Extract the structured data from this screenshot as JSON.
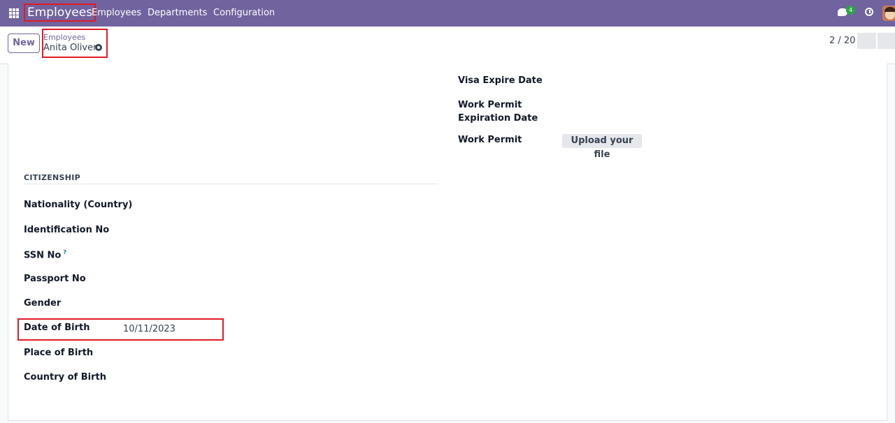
{
  "topbar": {
    "app_name": "Employees",
    "menu": [
      "Employees",
      "Departments",
      "Configuration"
    ],
    "chat_count": "4",
    "colors": {
      "navbar": "#71639e",
      "highlight": "#e01b24"
    }
  },
  "control": {
    "new_label": "New",
    "breadcrumb_parent": "Employees",
    "breadcrumb_current": "Anita Oliver",
    "pager": "2 / 20"
  },
  "form": {
    "right_labels": {
      "visa_expire": "Visa Expire Date",
      "work_permit_exp_1": "Work Permit",
      "work_permit_exp_2": "Expiration Date",
      "work_permit": "Work Permit",
      "upload": "Upload your file"
    },
    "citizenship": {
      "title": "CITIZENSHIP",
      "nationality": "Nationality (Country)",
      "identification": "Identification No",
      "ssn": "SSN No",
      "ssn_help": "?",
      "passport": "Passport No",
      "gender": "Gender",
      "dob": "Date of Birth",
      "dob_value": "10/11/2023",
      "place_of_birth": "Place of Birth",
      "country_of_birth": "Country of Birth"
    }
  }
}
